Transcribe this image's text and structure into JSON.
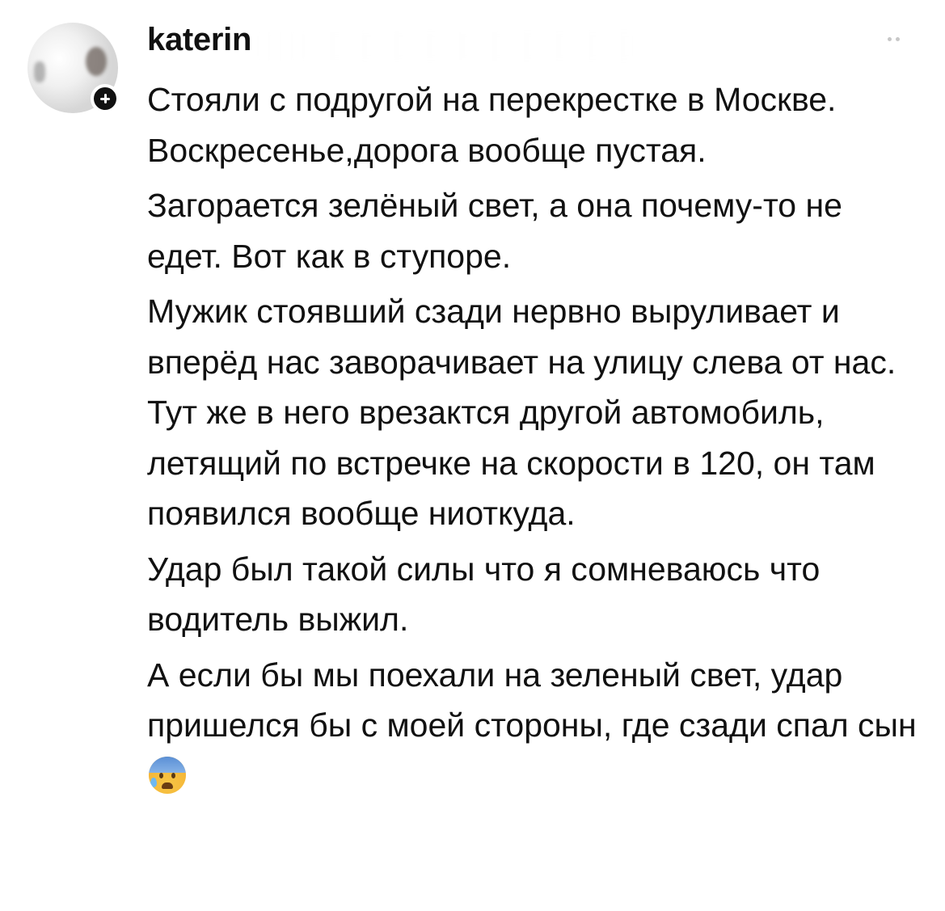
{
  "comment": {
    "username": "katerin",
    "avatar_icon": "user-avatar",
    "follow_badge_icon": "plus-icon",
    "more_icon": "more-dots-icon",
    "paragraphs": [
      "Стояли с подругой на перекрестке в Москве. Воскресенье,дорога вообще пустая.",
      "Загорается зелёный свет, а она почему-то не едет. Вот как в ступоре.",
      "Мужик стоявший сзади нервно выруливает и вперёд нас заворачивает на улицу слева от нас. Тут же в него врезактся другой автомобиль, летящий по встречке на скорости в 120, он там появился вообще ниоткуда.",
      "Удар был такой силы что я сомневаюсь что водитель выжил.",
      "А если бы мы поехали на зеленый свет, удар пришелся бы с моей стороны, где сзади спал сын"
    ],
    "final_emoji_icon": "anxious-face-with-sweat-icon"
  }
}
